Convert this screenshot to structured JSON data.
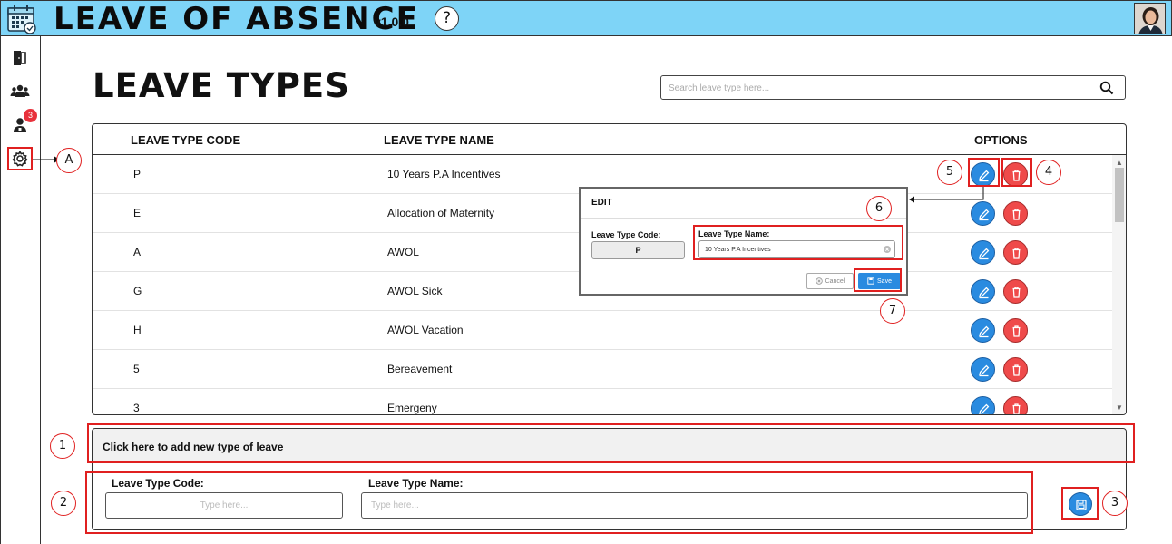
{
  "app": {
    "title": "LEAVE OF ABSENCE",
    "version": "v1.0.0",
    "help_label": "?"
  },
  "sidebar": {
    "items": [
      {
        "name": "door-icon"
      },
      {
        "name": "users-icon"
      },
      {
        "name": "user-requests-icon",
        "badge": "3"
      },
      {
        "name": "gear-icon",
        "active": true
      }
    ]
  },
  "page": {
    "title": "LEAVE TYPES",
    "search_placeholder": "Search leave type here..."
  },
  "table": {
    "headers": {
      "code": "LEAVE TYPE CODE",
      "name": "LEAVE TYPE NAME",
      "options": "OPTIONS"
    },
    "rows": [
      {
        "code": "P",
        "name": "10 Years P.A Incentives"
      },
      {
        "code": "E",
        "name": "Allocation of Maternity"
      },
      {
        "code": "A",
        "name": "AWOL"
      },
      {
        "code": "G",
        "name": "AWOL Sick"
      },
      {
        "code": "H",
        "name": "AWOL Vacation"
      },
      {
        "code": "5",
        "name": "Bereavement"
      },
      {
        "code": "3",
        "name": "Emergeny"
      }
    ]
  },
  "edit_modal": {
    "title": "EDIT",
    "code_label": "Leave Type Code:",
    "code_value": "P",
    "name_label": "Leave Type Name:",
    "name_value": "10 Years P.A Incentives",
    "cancel_label": "Cancel",
    "save_label": "Save"
  },
  "add_form": {
    "header_label": "Click here to add new type of leave",
    "code_label": "Leave Type Code:",
    "code_placeholder": "Type here...",
    "name_label": "Leave Type Name:",
    "name_placeholder": "Type here..."
  },
  "annotations": {
    "a": "A",
    "n1": "1",
    "n2": "2",
    "n3": "3",
    "n4": "4",
    "n5": "5",
    "n6": "6",
    "n7": "7"
  },
  "colors": {
    "header_bg": "#7ed4f7",
    "edit_button": "#2a8be0",
    "delete_button": "#ef4a4a",
    "annotation": "#e02020",
    "badge": "#e8323c"
  }
}
